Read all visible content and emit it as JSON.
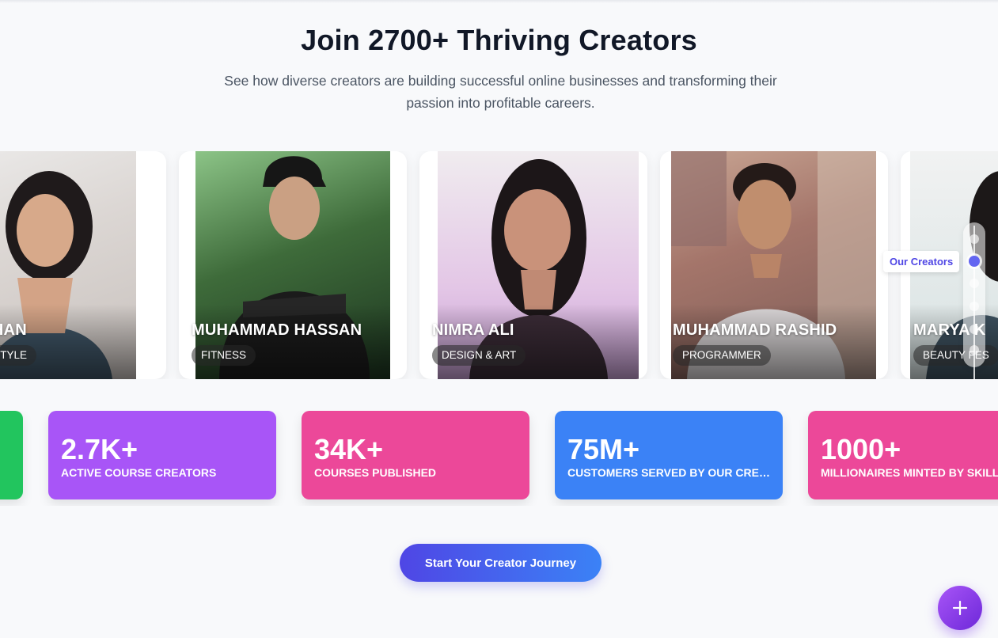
{
  "heading": {
    "title": "Join 2700+ Thriving Creators",
    "subtitle": "See how diverse creators are building successful online businesses and transforming their passion into profitable careers."
  },
  "creators": [
    {
      "name": "AM KHAN",
      "category": "& LIFESTYLE"
    },
    {
      "name": "MUHAMMAD HASSAN",
      "category": "FITNESS"
    },
    {
      "name": "NIMRA ALI",
      "category": "DESIGN & ART"
    },
    {
      "name": "MUHAMMAD RASHID",
      "category": "PROGRAMMER"
    },
    {
      "name": "MARYA   K",
      "category": "BEAUTY   FES"
    }
  ],
  "stats": [
    {
      "value": "",
      "label": "",
      "color": "#22c55e"
    },
    {
      "value": "2.7K+",
      "label": "ACTIVE COURSE CREATORS",
      "color": "#a855f7"
    },
    {
      "value": "34K+",
      "label": "COURSES PUBLISHED",
      "color": "#ec4899"
    },
    {
      "value": "75M+",
      "label": "CUSTOMERS SERVED BY OUR CREATORS",
      "color": "#3b82f6"
    },
    {
      "value": "1000+",
      "label": "MILLIONAIRES MINTED BY SKILLBA",
      "color": "#ec4899"
    }
  ],
  "cta": {
    "label": "Start Your Creator Journey"
  },
  "section_nav": {
    "active_label": "Our Creators",
    "dot_count": 6,
    "active_index": 1
  },
  "fab": {
    "icon": "plus-icon"
  },
  "colors": {
    "accent": "#4f46e5",
    "background": "#f8f9fb"
  }
}
